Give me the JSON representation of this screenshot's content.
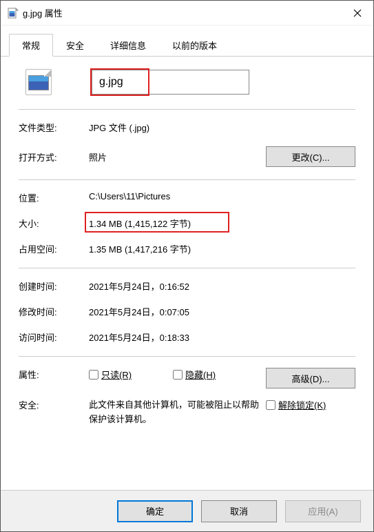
{
  "titlebar": {
    "title": "g.jpg 属性",
    "close_icon": "close-icon"
  },
  "tabs": {
    "general": "常规",
    "security": "安全",
    "details": "详细信息",
    "previous": "以前的版本"
  },
  "file": {
    "name": "g.jpg"
  },
  "labels": {
    "file_type": "文件类型:",
    "opens_with": "打开方式:",
    "location": "位置:",
    "size": "大小:",
    "size_on_disk": "占用空间:",
    "created": "创建时间:",
    "modified": "修改时间:",
    "accessed": "访问时间:",
    "attributes": "属性:",
    "security_label": "安全:"
  },
  "values": {
    "file_type": "JPG 文件 (.jpg)",
    "opens_with": "照片",
    "location": "C:\\Users\\11\\Pictures",
    "size": "1.34 MB (1,415,122 字节)",
    "size_on_disk": "1.35 MB (1,417,216 字节)",
    "created": "2021年5月24日，0:16:52",
    "modified": "2021年5月24日，0:07:05",
    "accessed": "2021年5月24日，0:18:33"
  },
  "buttons": {
    "change": "更改(C)...",
    "advanced": "高级(D)...",
    "ok": "确定",
    "cancel": "取消",
    "apply": "应用(A)"
  },
  "checkboxes": {
    "readonly": "只读(R)",
    "hidden": "隐藏(H)",
    "unblock": "解除锁定(K)"
  },
  "security_text": "此文件来自其他计算机，可能被阻止以帮助保护该计算机。"
}
